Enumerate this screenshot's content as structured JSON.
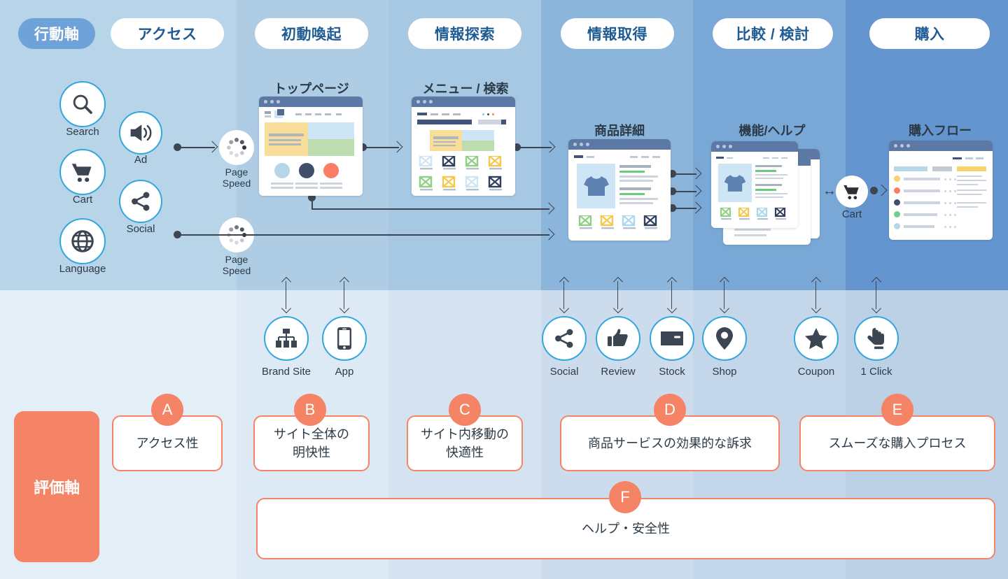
{
  "legend": {
    "behavior_axis": "行動軸",
    "evaluation_axis": "評価軸"
  },
  "stages": [
    {
      "label": "アクセス"
    },
    {
      "label": "初動喚起"
    },
    {
      "label": "情報探索"
    },
    {
      "label": "情報取得"
    },
    {
      "label": "比較 / 検討"
    },
    {
      "label": "購入"
    }
  ],
  "captions": {
    "top_page": "トップページ",
    "menu_search": "メニュー / 検索",
    "product_detail": "商品詳細",
    "feature_help": "機能/ヘルプ",
    "purchase_flow": "購入フロー"
  },
  "access_icons": [
    {
      "label": "Search",
      "icon": "magnifier-icon"
    },
    {
      "label": "Cart",
      "icon": "shopping-cart-icon"
    },
    {
      "label": "Language",
      "icon": "globe-icon"
    },
    {
      "label": "Ad",
      "icon": "megaphone-icon"
    },
    {
      "label": "Social",
      "icon": "share-icon"
    }
  ],
  "page_speed": [
    {
      "label_line1": "Page",
      "label_line2": "Speed"
    },
    {
      "label_line1": "Page",
      "label_line2": "Speed"
    }
  ],
  "cart_node": {
    "label": "Cart",
    "icon": "shopping-cart-icon"
  },
  "touchpoints": [
    {
      "label": "Brand Site",
      "icon": "sitemap-icon"
    },
    {
      "label": "App",
      "icon": "smartphone-icon"
    },
    {
      "label": "Social",
      "icon": "share-icon"
    },
    {
      "label": "Review",
      "icon": "thumbs-up-icon"
    },
    {
      "label": "Stock",
      "icon": "box-icon"
    },
    {
      "label": "Shop",
      "icon": "map-pin-icon"
    },
    {
      "label": "Coupon",
      "icon": "star-icon"
    },
    {
      "label": "1 Click",
      "icon": "pointing-hand-icon"
    }
  ],
  "eval_cards": [
    {
      "badge": "A",
      "text": "アクセス性"
    },
    {
      "badge": "B",
      "text": "サイト全体の\n明快性"
    },
    {
      "badge": "C",
      "text": "サイト内移動の\n快適性"
    },
    {
      "badge": "D",
      "text": "商品サービスの効果的な訴求"
    },
    {
      "badge": "E",
      "text": "スムーズな購入プロセス"
    },
    {
      "badge": "F",
      "text": "ヘルプ・安全性"
    }
  ],
  "colors": {
    "accent_blue": "#6ea2d8",
    "icon_ring": "#32a7dd",
    "orange": "#f58466",
    "pill_text": "#1f5c93",
    "band_top": [
      "#b8d4e8",
      "#aecde5",
      "#a7c8e3",
      "#8cb5dc",
      "#7aa8d6",
      "#6495ce"
    ],
    "band_bottom": [
      "#e4eef7",
      "#dde9f4",
      "#d5e3f0",
      "#cddced",
      "#c3d6ea",
      "#bcd0e6"
    ]
  }
}
